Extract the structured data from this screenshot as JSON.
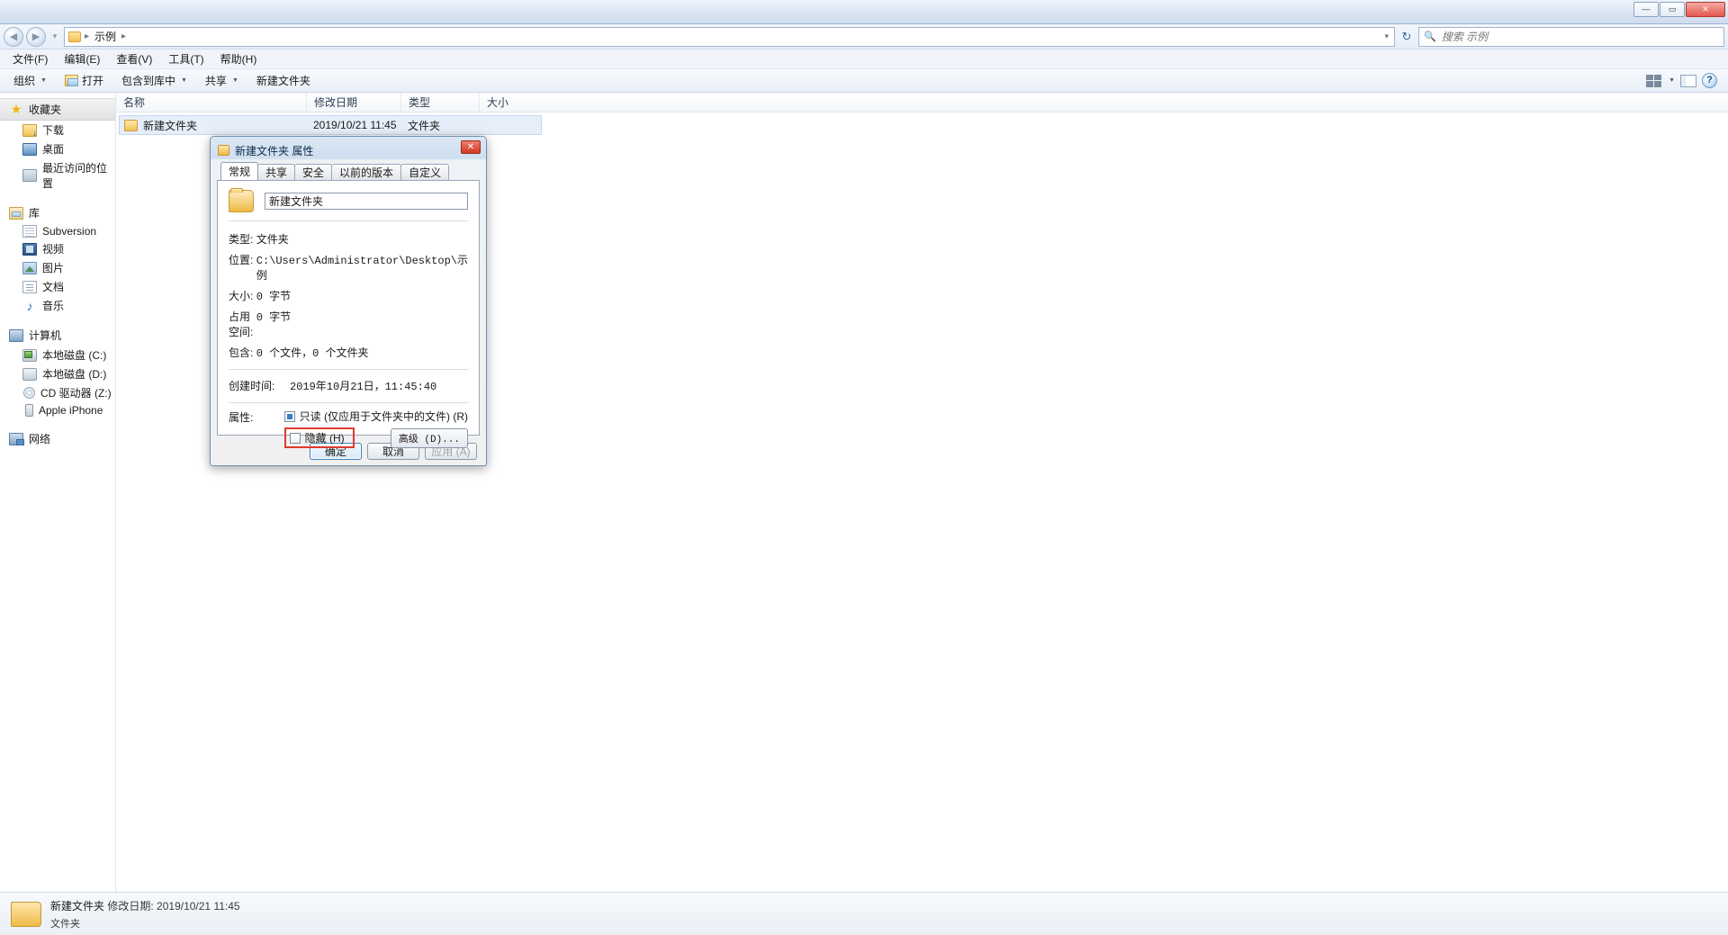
{
  "window": {
    "minimize_label": "—",
    "maximize_label": "▭",
    "close_label": "✕"
  },
  "address": {
    "back_label": "◀",
    "forward_label": "▶",
    "history_label": "▾",
    "crumb_sep": "▸",
    "crumb_current": "示例",
    "dropdown_label": "▾",
    "refresh_label": "↻"
  },
  "search": {
    "placeholder": "搜索 示例",
    "icon": "search-icon",
    "glyph": "🔍"
  },
  "menu": {
    "items": [
      {
        "label": "文件(F)"
      },
      {
        "label": "编辑(E)"
      },
      {
        "label": "查看(V)"
      },
      {
        "label": "工具(T)"
      },
      {
        "label": "帮助(H)"
      }
    ]
  },
  "toolbar": {
    "organize_label": "组织",
    "open_label": "打开",
    "include_library_label": "包含到库中",
    "share_label": "共享",
    "new_folder_label": "新建文件夹",
    "caret": "▼",
    "help_label": "?"
  },
  "sidebar": {
    "groups": [
      {
        "name": "favorites",
        "label": "收藏夹",
        "icon": "star-icon",
        "selected": true,
        "children": [
          {
            "label": "下载",
            "icon": "downloads-icon"
          },
          {
            "label": "桌面",
            "icon": "desktop-icon"
          },
          {
            "label": "最近访问的位置",
            "icon": "recent-places-icon"
          }
        ]
      },
      {
        "name": "libraries",
        "label": "库",
        "icon": "library-icon",
        "selected": false,
        "children": [
          {
            "label": "Subversion",
            "icon": "subversion-icon"
          },
          {
            "label": "视频",
            "icon": "videos-icon"
          },
          {
            "label": "图片",
            "icon": "pictures-icon"
          },
          {
            "label": "文档",
            "icon": "documents-icon"
          },
          {
            "label": "音乐",
            "icon": "music-icon"
          }
        ]
      },
      {
        "name": "computer",
        "label": "计算机",
        "icon": "computer-icon",
        "selected": false,
        "children": [
          {
            "label": "本地磁盘 (C:)",
            "icon": "system-drive-icon"
          },
          {
            "label": "本地磁盘 (D:)",
            "icon": "drive-icon"
          },
          {
            "label": "CD 驱动器 (Z:)",
            "icon": "cd-drive-icon"
          },
          {
            "label": "Apple iPhone",
            "icon": "phone-icon"
          }
        ]
      },
      {
        "name": "network",
        "label": "网络",
        "icon": "network-icon",
        "selected": false,
        "children": []
      }
    ]
  },
  "filelist": {
    "columns": [
      {
        "key": "name",
        "label": "名称"
      },
      {
        "key": "date",
        "label": "修改日期"
      },
      {
        "key": "type",
        "label": "类型"
      },
      {
        "key": "size",
        "label": "大小"
      }
    ],
    "rows": [
      {
        "name": "新建文件夹",
        "date": "2019/10/21 11:45",
        "type": "文件夹",
        "size": "",
        "icon": "folder-icon",
        "selected": true
      }
    ]
  },
  "statusbar": {
    "icon": "folder-icon",
    "name": "新建文件夹",
    "modified_label": "修改日期:",
    "modified_value": "2019/10/21 11:45",
    "type": "文件夹"
  },
  "dialog": {
    "title": "新建文件夹 属性",
    "title_icon": "folder-icon",
    "close_label": "✕",
    "tabs": [
      {
        "label": "常规",
        "active": true
      },
      {
        "label": "共享",
        "active": false
      },
      {
        "label": "安全",
        "active": false
      },
      {
        "label": "以前的版本",
        "active": false
      },
      {
        "label": "自定义",
        "active": false
      }
    ],
    "name_value": "新建文件夹",
    "properties": [
      {
        "label": "类型:",
        "value": "文件夹",
        "cjk": true
      },
      {
        "label": "位置:",
        "value": "C:\\Users\\Administrator\\Desktop\\示例",
        "cjk": false
      },
      {
        "label": "大小:",
        "value": "0 字节",
        "cjk": false
      },
      {
        "label": "占用空间:",
        "value": "0 字节",
        "cjk": false
      },
      {
        "label": "包含:",
        "value": "0 个文件，0 个文件夹",
        "cjk": false
      }
    ],
    "created": {
      "label": "创建时间:",
      "value": "2019年10月21日，11:45:40"
    },
    "attributes_label": "属性:",
    "readonly": {
      "label": "只读 (仅应用于文件夹中的文件) (R)",
      "checked": true
    },
    "hidden": {
      "label": "隐藏 (H)",
      "checked": false,
      "highlight_color": "#e03a2f"
    },
    "advanced_label": "高级 (D)...",
    "buttons": {
      "ok": "确定",
      "cancel": "取消",
      "apply": "应用 (A)"
    }
  }
}
